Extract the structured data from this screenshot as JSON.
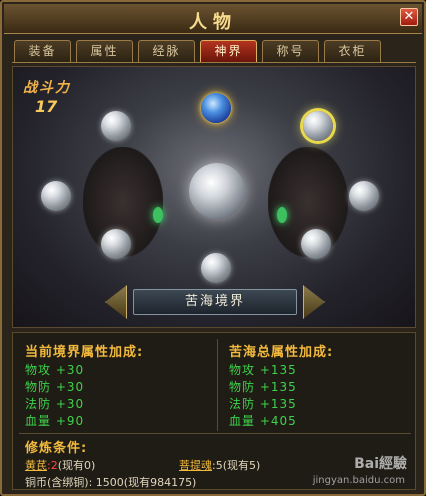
{
  "window": {
    "title": "人物",
    "close_label": "✕"
  },
  "tabs": [
    {
      "label": "装备",
      "active": false
    },
    {
      "label": "属性",
      "active": false
    },
    {
      "label": "经脉",
      "active": false
    },
    {
      "label": "神界",
      "active": true
    },
    {
      "label": "称号",
      "active": false
    },
    {
      "label": "衣柜",
      "active": false
    }
  ],
  "scene": {
    "combat_power_label": "战斗力",
    "combat_power_value": "17",
    "realm_name": "苦海境界"
  },
  "current_bonus": {
    "title": "当前境界属性加成:",
    "lines": [
      "物攻 +30",
      "物防 +30",
      "法防 +30",
      "血量 +90"
    ]
  },
  "total_bonus": {
    "title": "苦海总属性加成:",
    "lines": [
      "物攻 +135",
      "物防 +135",
      "法防 +135",
      "血量 +405"
    ]
  },
  "conditions": {
    "title": "修炼条件:",
    "item1_name": "黄芪",
    "item1_qty": ":2",
    "item1_have": "(现有0)",
    "item2_name": "菩提魂",
    "item2_qty": ":5(现有5)",
    "copper": "铜币(含绑铜): 1500(现有984175)"
  },
  "watermark": {
    "text": "Bai經驗",
    "url": "jingyan.baidu.com"
  },
  "colors": {
    "accent_gold": "#f2b93c",
    "stat_green": "#3fd14a",
    "active_tab": "#b43420"
  }
}
